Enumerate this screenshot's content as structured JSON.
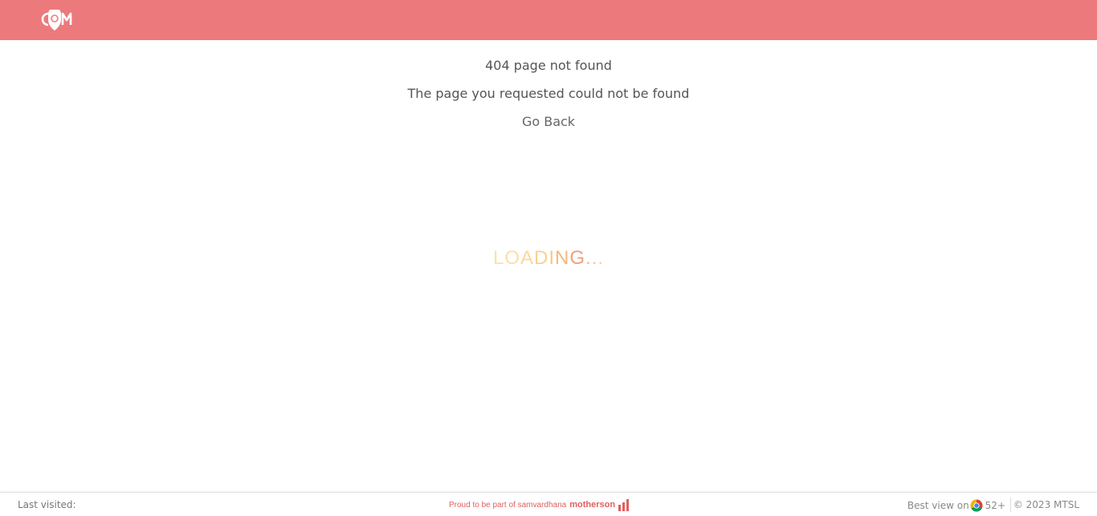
{
  "header": {
    "logo_alt": "logo"
  },
  "error": {
    "title": "404 page not found",
    "message": "The page you requested could not be found",
    "go_back_label": "Go Back"
  },
  "loading": {
    "letters": [
      "L",
      "O",
      "A",
      "D",
      "I",
      "N",
      "G",
      ".",
      ".",
      "."
    ],
    "colors": [
      "#fbe3a8",
      "#fbe0a3",
      "#fad99a",
      "#f9d190",
      "#f8c786",
      "#f5b97a",
      "#f0a080",
      "#f2b7a0",
      "#f5c5b0",
      "#f7d0c0"
    ]
  },
  "footer": {
    "last_visited_label": "Last visited:",
    "proud_text": "Proud to be part of samvardhana",
    "brand": "motherson",
    "best_view_label": "Best view on",
    "browser_version": "52+",
    "copyright": "© 2023 MTSL"
  },
  "colors": {
    "header_bg": "#ec7a7c",
    "brand": "#e0605f"
  }
}
